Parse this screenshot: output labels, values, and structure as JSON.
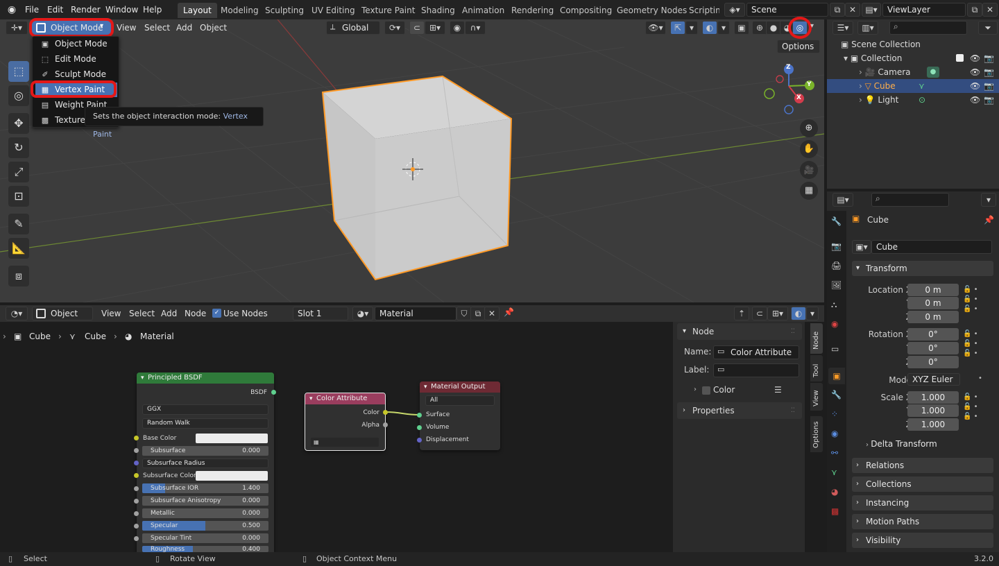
{
  "topbar": {
    "menus": [
      "File",
      "Edit",
      "Render",
      "Window",
      "Help"
    ],
    "workspaces": [
      "Layout",
      "Modeling",
      "Sculpting",
      "UV Editing",
      "Texture Paint",
      "Shading",
      "Animation",
      "Rendering",
      "Compositing",
      "Geometry Nodes",
      "Scripting"
    ],
    "active_workspace": "Layout",
    "scene": "Scene",
    "view_layer": "ViewLayer"
  },
  "viewport": {
    "mode": "Object Mode",
    "menus": [
      "View",
      "Select",
      "Add",
      "Object"
    ],
    "transform_orientation": "Global",
    "options_label": "Options",
    "axes": {
      "x": "X",
      "y": "Y",
      "z": "Z"
    }
  },
  "mode_menu": {
    "items": [
      "Object Mode",
      "Edit Mode",
      "Sculpt Mode",
      "Vertex Paint",
      "Weight Paint",
      "Texture Paint"
    ],
    "highlighted": "Vertex Paint",
    "tooltip_text": "Sets the object interaction mode:",
    "tooltip_value": "Vertex Paint"
  },
  "outliner": {
    "root": "Scene Collection",
    "collection": "Collection",
    "items": [
      "Camera",
      "Cube",
      "Light"
    ],
    "selected": "Cube"
  },
  "properties": {
    "object_name": "Cube",
    "data_name": "Cube",
    "transform_label": "Transform",
    "location_label": "Location X",
    "location": [
      "0 m",
      "0 m",
      "0 m"
    ],
    "rotation_label": "Rotation X",
    "rotation": [
      "0°",
      "0°",
      "0°"
    ],
    "mode_label": "Mode",
    "rotation_mode": "XYZ Euler",
    "scale_label": "Scale X",
    "scale": [
      "1.000",
      "1.000",
      "1.000"
    ],
    "y_label": "Y",
    "z_label": "Z",
    "sections": [
      "Delta Transform",
      "Relations",
      "Collections",
      "Instancing",
      "Motion Paths",
      "Visibility"
    ]
  },
  "node_editor": {
    "type": "Object",
    "menus": [
      "View",
      "Select",
      "Add",
      "Node"
    ],
    "use_nodes": "Use Nodes",
    "slot": "Slot 1",
    "material": "Material",
    "breadcrumb": [
      "Cube",
      "Cube",
      "Material"
    ],
    "bsdf": {
      "title": "Principled BSDF",
      "output": "BSDF",
      "distribution": "GGX",
      "subsurface_method": "Random Walk",
      "base_color": "Base Color",
      "rows": [
        {
          "label": "Subsurface",
          "value": "0.000"
        },
        {
          "label": "Subsurface Radius",
          "value": ""
        },
        {
          "label": "Subsurface Color",
          "value": ""
        },
        {
          "label": "Subsurface IOR",
          "value": "1.400"
        },
        {
          "label": "Subsurface Anisotropy",
          "value": "0.000"
        },
        {
          "label": "Metallic",
          "value": "0.000"
        },
        {
          "label": "Specular",
          "value": "0.500"
        },
        {
          "label": "Specular Tint",
          "value": "0.000"
        },
        {
          "label": "Roughness",
          "value": "0.400"
        }
      ]
    },
    "color_attr": {
      "title": "Color Attribute",
      "color": "Color",
      "alpha": "Alpha"
    },
    "mat_output": {
      "title": "Material Output",
      "target": "All",
      "surface": "Surface",
      "volume": "Volume",
      "displacement": "Displacement"
    },
    "panel": {
      "section": "Node",
      "name_label": "Name:",
      "name_value": "Color Attribute",
      "label_label": "Label:",
      "color_sub": "Color",
      "properties": "Properties",
      "tabs": [
        "Node",
        "Tool",
        "View",
        "Options"
      ]
    }
  },
  "status": {
    "select": "Select",
    "rotate": "Rotate View",
    "context": "Object Context Menu",
    "version": "3.2.0"
  },
  "colors": {
    "accent": "#4772b3",
    "highlight_ring": "#e31818",
    "selection": "#ff9a26"
  }
}
